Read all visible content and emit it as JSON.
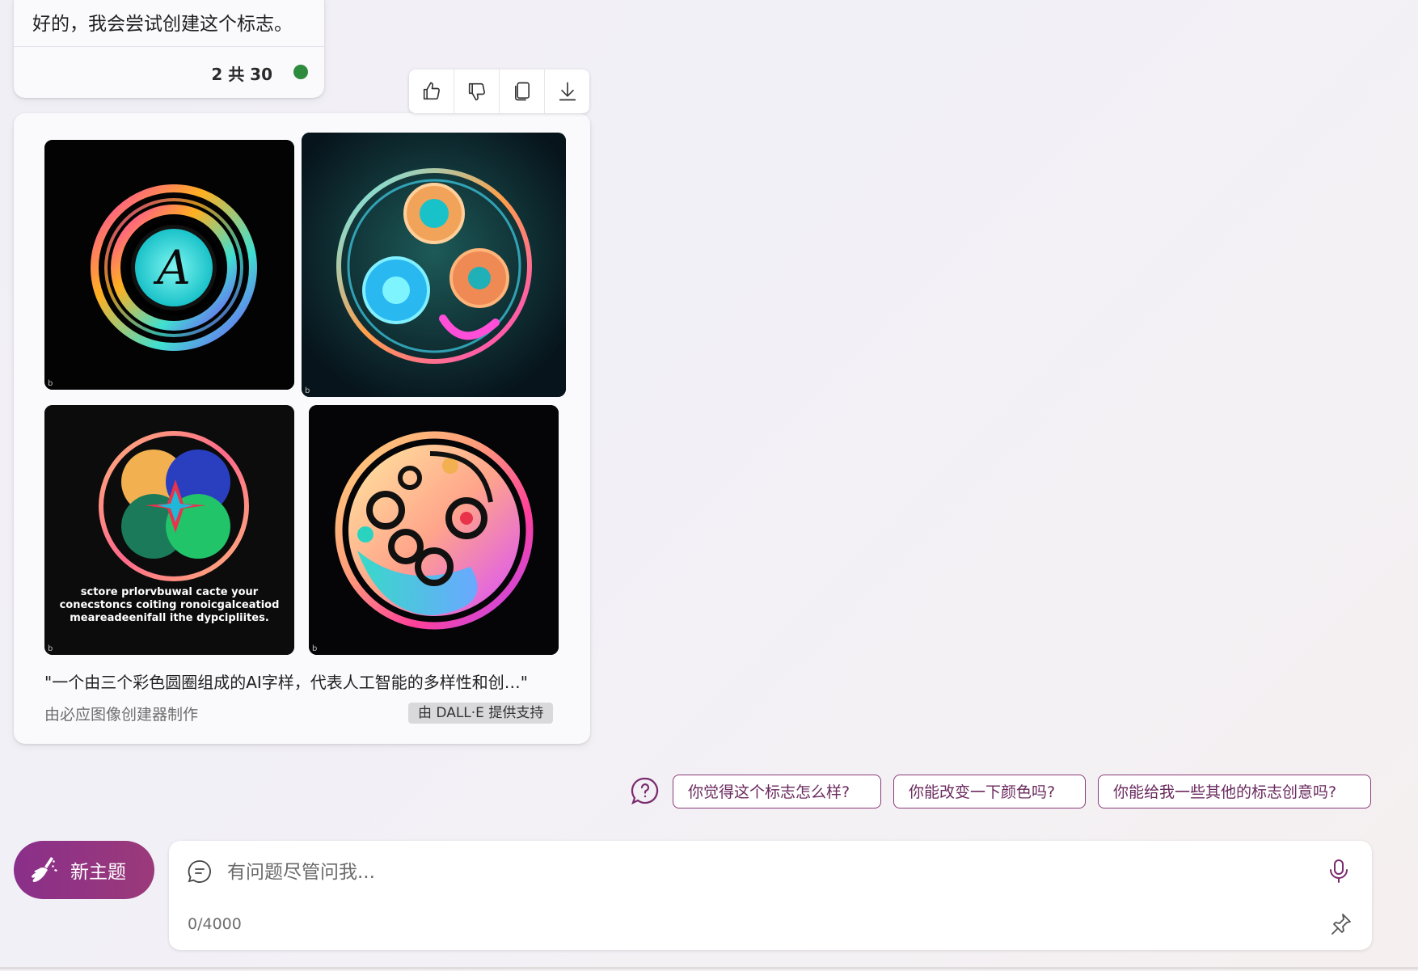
{
  "previous_message": {
    "text": "好的，我会尝试创建这个标志。",
    "counter": "2 共 30",
    "status_color": "#2e8b3e"
  },
  "toolbar": {
    "items": [
      {
        "icon": "thumbs-up-icon"
      },
      {
        "icon": "thumbs-down-icon"
      },
      {
        "icon": "copy-icon"
      },
      {
        "icon": "download-icon"
      }
    ]
  },
  "image_card": {
    "images": [
      {
        "icon": "logo-image-1",
        "watermark": "b"
      },
      {
        "icon": "logo-image-2",
        "watermark": "b"
      },
      {
        "icon": "logo-image-3",
        "watermark": "b",
        "text_lines": [
          "sctore prlorvbuwal cacte your",
          "conecstoncs coiting ronoicgalceatiod",
          "meareadeenifall ithe dypcipliites."
        ]
      },
      {
        "icon": "logo-image-4",
        "watermark": "b"
      }
    ],
    "caption": "\"一个由三个彩色圆圈组成的AI字样，代表人工智能的多样性和创…\"",
    "creator": "由必应图像创建器制作",
    "badge": "由 DALL·E 提供支持"
  },
  "suggestions": {
    "icon": "question-bubble-icon",
    "chips": [
      "你觉得这个标志怎么样?",
      "你能改变一下颜色吗?",
      "你能给我一些其他的标志创意吗?"
    ]
  },
  "new_topic": {
    "label": "新主题",
    "icon": "broom-icon",
    "gradient": [
      "#8a2f8a",
      "#9b3a7a"
    ]
  },
  "input": {
    "placeholder": "有问题尽管问我...",
    "value": "",
    "char_count": "0/4000"
  },
  "colors": {
    "accent": "#8a3a78"
  }
}
